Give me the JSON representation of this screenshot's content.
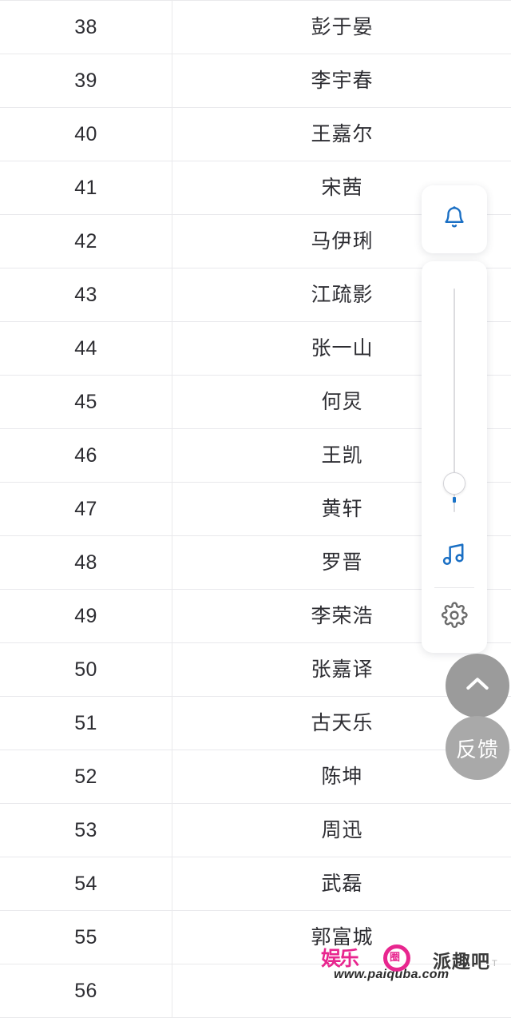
{
  "table": {
    "columns": [
      "rank",
      "name"
    ],
    "rows": [
      {
        "rank": "38",
        "name": "彭于晏"
      },
      {
        "rank": "39",
        "name": "李宇春"
      },
      {
        "rank": "40",
        "name": "王嘉尔"
      },
      {
        "rank": "41",
        "name": "宋茜"
      },
      {
        "rank": "42",
        "name": "马伊琍"
      },
      {
        "rank": "43",
        "name": "江疏影"
      },
      {
        "rank": "44",
        "name": "张一山"
      },
      {
        "rank": "45",
        "name": "何炅"
      },
      {
        "rank": "46",
        "name": "王凯"
      },
      {
        "rank": "47",
        "name": "黄轩"
      },
      {
        "rank": "48",
        "name": "罗晋"
      },
      {
        "rank": "49",
        "name": "李荣浩"
      },
      {
        "rank": "50",
        "name": "张嘉译"
      },
      {
        "rank": "51",
        "name": "古天乐"
      },
      {
        "rank": "52",
        "name": "陈坤"
      },
      {
        "rank": "53",
        "name": "周迅"
      },
      {
        "rank": "54",
        "name": "武磊"
      },
      {
        "rank": "55",
        "name": "郭富城"
      },
      {
        "rank": "56",
        "name": ""
      }
    ]
  },
  "side_widget": {
    "notification_icon": "bell-icon",
    "slider": {
      "orientation": "vertical",
      "value_position_pct": 87
    },
    "music_icon": "music-note-icon",
    "settings_icon": "gear-icon",
    "accent_color": "#1a73c8",
    "panel_background": "#ffffff"
  },
  "floating_buttons": {
    "back_to_top": {
      "icon": "chevron-up-icon",
      "background": "#9b9b9b"
    },
    "feedback": {
      "label": "反馈",
      "background": "#a9a9a9"
    }
  },
  "watermark": {
    "logo_text": "娱乐",
    "logo_seal": "圈",
    "url": "www.paiquba.com",
    "brand": "派趣吧",
    "logo_color": "#e8268f",
    "corner_mark": "T"
  }
}
